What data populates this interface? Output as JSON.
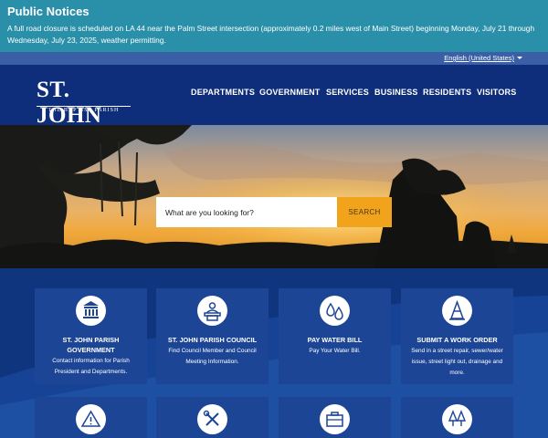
{
  "notice": {
    "title": "Public Notices",
    "text": "A full road closure is scheduled on LA 44 near the Palm Street intersection (approximately 0.2 miles west of Main Street) beginning Monday, July 21 through Wednesday, July 23, 2025, weather permitting."
  },
  "language": {
    "selected": "English (United States)"
  },
  "logo": {
    "main": "ST. JOHN",
    "sub": "THE BAPTIST PARISH"
  },
  "nav": [
    "DEPARTMENTS",
    "GOVERNMENT",
    "SERVICES",
    "BUSINESS",
    "RESIDENTS",
    "VISITORS"
  ],
  "search": {
    "placeholder": "What are you looking for?",
    "button": "SEARCH"
  },
  "cards": [
    {
      "icon": "building-icon",
      "title": "ST. JOHN PARISH GOVERNMENT",
      "desc": "Contact information for Parish President and Departments."
    },
    {
      "icon": "council-podium-icon",
      "title": "ST. JOHN PARISH COUNCIL",
      "desc": "Find Council Member and Council Meeting Information."
    },
    {
      "icon": "water-drops-icon",
      "title": "PAY WATER BILL",
      "desc": "Pay Your Water Bill."
    },
    {
      "icon": "traffic-cone-icon",
      "title": "SUBMIT A WORK ORDER",
      "desc": "Send in a street repair, sewer/water issue, street light out, drainage and more."
    }
  ],
  "cards_row2_icons": [
    "warning-icon",
    "tools-icon",
    "briefcase-icon",
    "trees-icon"
  ],
  "colors": {
    "notice": "#2a8fa8",
    "header": "#0e2d7a",
    "accent": "#f2a31c",
    "card": "#1d4596"
  }
}
